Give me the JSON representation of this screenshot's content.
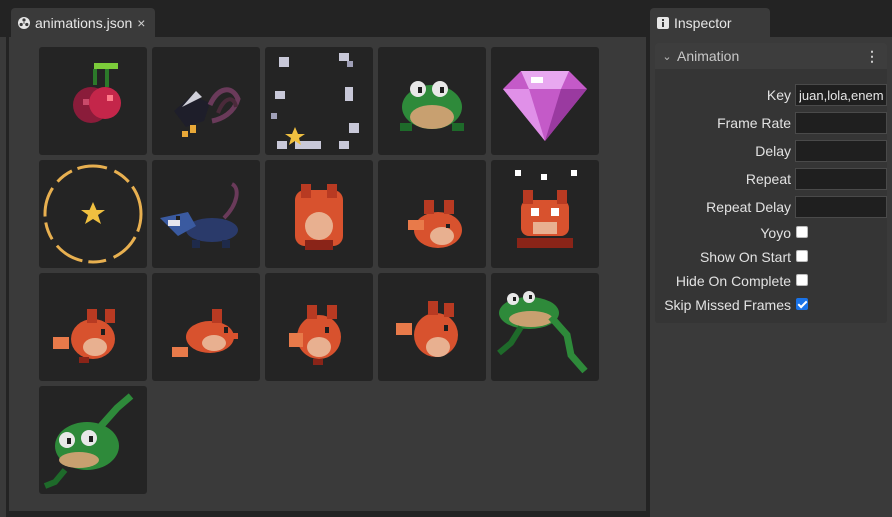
{
  "editor_tab": {
    "title": "animations.json",
    "close": "×"
  },
  "inspector_tab": {
    "title": "Inspector"
  },
  "section": {
    "title": "Animation",
    "menu": "⋮",
    "chevron": "⌄"
  },
  "fields": {
    "key": {
      "label": "Key",
      "value": "juan,lola,enem"
    },
    "frame_rate": {
      "label": "Frame Rate",
      "value": ""
    },
    "delay": {
      "label": "Delay",
      "value": ""
    },
    "repeat": {
      "label": "Repeat",
      "value": ""
    },
    "repeat_delay": {
      "label": "Repeat Delay",
      "value": ""
    }
  },
  "checks": {
    "yoyo": {
      "label": "Yoyo",
      "checked": false
    },
    "show_on_start": {
      "label": "Show On Start",
      "checked": false
    },
    "hide_on_complete": {
      "label": "Hide On Complete",
      "checked": false
    },
    "skip_missed_frames": {
      "label": "Skip Missed Frames",
      "checked": true
    }
  },
  "sprites": [
    "cherry",
    "bat-swoop",
    "sparkle-ring",
    "frog-idle",
    "gem",
    "star-ring",
    "opossum",
    "fox-climb",
    "fox-crouch",
    "fox-hurt",
    "fox-idle-1",
    "fox-run",
    "fox-idle-2",
    "fox-jump",
    "frog-jump",
    "frog-fall"
  ],
  "colors": {
    "accent": "#1a73e8",
    "panel": "#3a3a3a",
    "cell": "#242424"
  }
}
